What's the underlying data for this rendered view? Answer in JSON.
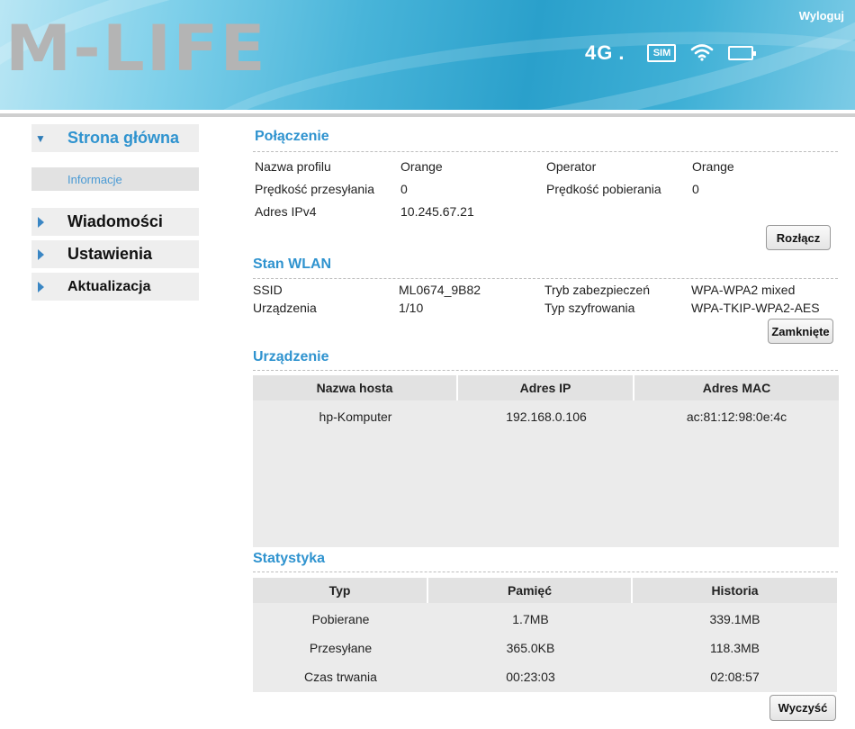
{
  "header": {
    "logo": "M-LIFE",
    "logout_label": "Wyloguj",
    "network": "4G",
    "network_dot": ".",
    "sim_label": "SIM",
    "icons": [
      "sim-icon",
      "wifi-icon",
      "battery-icon"
    ]
  },
  "sidebar": {
    "home": "Strona główna",
    "home_sub": "Informacje",
    "items": [
      "Wiadomości",
      "Ustawienia",
      "Aktualizacja"
    ]
  },
  "connection": {
    "title": "Połączenie",
    "profile_label": "Nazwa profilu",
    "profile_value": "Orange",
    "operator_label": "Operator",
    "operator_value": "Orange",
    "upload_label": "Prędkość przesyłania",
    "upload_value": "0",
    "download_label": "Prędkość pobierania",
    "download_value": "0",
    "ipv4_label": "Adres IPv4",
    "ipv4_value": "10.245.67.21",
    "button": "Rozłącz"
  },
  "wlan": {
    "title": "Stan WLAN",
    "ssid_label": "SSID",
    "ssid_value": "ML0674_9B82",
    "security_label": "Tryb zabezpieczeń",
    "security_value": "WPA-WPA2 mixed",
    "devices_label": "Urządzenia",
    "devices_value": "1/10",
    "encryption_label": "Typ szyfrowania",
    "encryption_value": "WPA-TKIP-WPA2-AES",
    "button": "Zamknięte"
  },
  "device": {
    "title": "Urządzenie",
    "columns": [
      "Nazwa hosta",
      "Adres IP",
      "Adres MAC"
    ],
    "rows": [
      [
        "hp-Komputer",
        "192.168.0.106",
        "ac:81:12:98:0e:4c"
      ]
    ]
  },
  "stats": {
    "title": "Statystyka",
    "columns": [
      "Typ",
      "Pamięć",
      "Historia"
    ],
    "rows": [
      [
        "Pobierane",
        "1.7MB",
        "339.1MB"
      ],
      [
        "Przesyłane",
        "365.0KB",
        "118.3MB"
      ],
      [
        "Czas trwania",
        "00:23:03",
        "02:08:57"
      ]
    ],
    "button": "Wyczyść"
  },
  "colors": {
    "accent": "#2f93cf",
    "header_gradient_start": "#b9e6f4",
    "header_gradient_end": "#2aa0cb"
  }
}
